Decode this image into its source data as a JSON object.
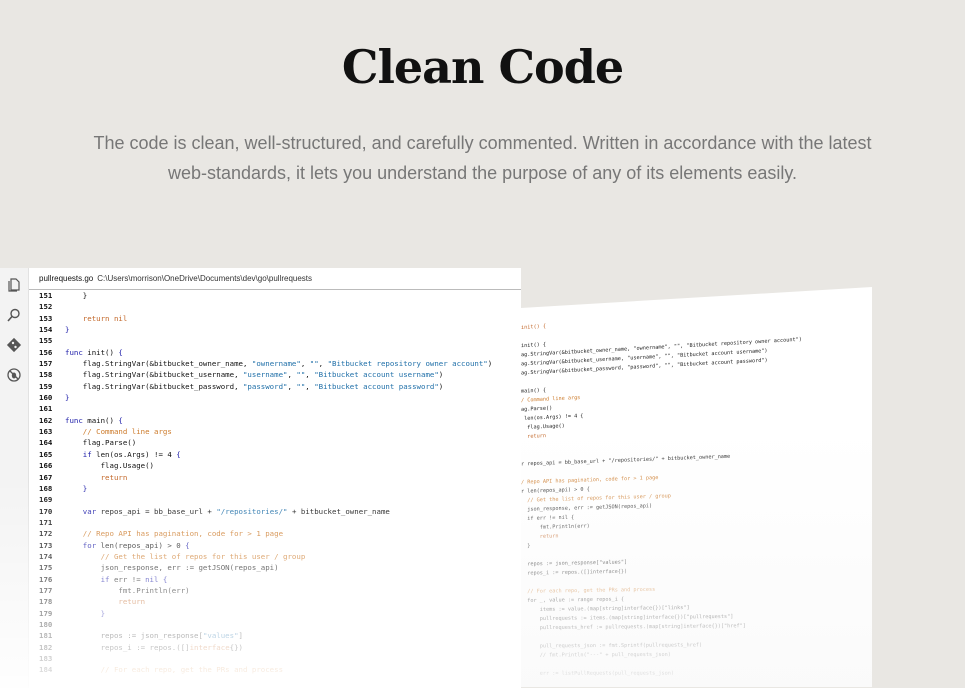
{
  "hero": {
    "title": "Clean Code",
    "subtitle": "The code is clean, well-structured, and carefully commented. Written in accordance with the latest web-standards, it lets you understand the purpose of any of its elements easily."
  },
  "editor": {
    "file_name": "pullrequests.go",
    "file_path": "C:\\Users\\morrison\\OneDrive\\Documents\\dev\\go\\pullrequests",
    "activity_icons": [
      "files-icon",
      "search-icon",
      "source-control-icon",
      "debug-icon"
    ],
    "lines": [
      {
        "n": "151",
        "segs": [
          [
            "plain",
            "    }"
          ]
        ]
      },
      {
        "n": "152",
        "segs": []
      },
      {
        "n": "153",
        "segs": [
          [
            "ret",
            "    return nil"
          ]
        ]
      },
      {
        "n": "154",
        "segs": [
          [
            "kw",
            "}"
          ]
        ]
      },
      {
        "n": "155",
        "segs": []
      },
      {
        "n": "156",
        "segs": [
          [
            "kw",
            "func "
          ],
          [
            "plain",
            "init() "
          ],
          [
            "kw",
            "{"
          ]
        ]
      },
      {
        "n": "157",
        "segs": [
          [
            "plain",
            "    flag.StringVar(&bitbucket_owner_name, "
          ],
          [
            "str",
            "\"ownername\""
          ],
          [
            "plain",
            ", "
          ],
          [
            "str",
            "\"\""
          ],
          [
            "plain",
            ", "
          ],
          [
            "str",
            "\"Bitbucket repository owner account\""
          ],
          [
            "plain",
            ")"
          ]
        ]
      },
      {
        "n": "158",
        "segs": [
          [
            "plain",
            "    flag.StringVar(&bitbucket_username, "
          ],
          [
            "str",
            "\"username\""
          ],
          [
            "plain",
            ", "
          ],
          [
            "str",
            "\"\""
          ],
          [
            "plain",
            ", "
          ],
          [
            "str",
            "\"Bitbucket account username\""
          ],
          [
            "plain",
            ")"
          ]
        ]
      },
      {
        "n": "159",
        "segs": [
          [
            "plain",
            "    flag.StringVar(&bitbucket_password, "
          ],
          [
            "str",
            "\"password\""
          ],
          [
            "plain",
            ", "
          ],
          [
            "str",
            "\"\""
          ],
          [
            "plain",
            ", "
          ],
          [
            "str",
            "\"Bitbucket account password\""
          ],
          [
            "plain",
            ")"
          ]
        ]
      },
      {
        "n": "160",
        "segs": [
          [
            "kw",
            "}"
          ]
        ]
      },
      {
        "n": "161",
        "segs": []
      },
      {
        "n": "162",
        "segs": [
          [
            "kw",
            "func "
          ],
          [
            "plain",
            "main() "
          ],
          [
            "kw",
            "{"
          ]
        ]
      },
      {
        "n": "163",
        "segs": [
          [
            "com",
            "    // Command line args"
          ]
        ]
      },
      {
        "n": "164",
        "segs": [
          [
            "plain",
            "    flag.Parse()"
          ]
        ]
      },
      {
        "n": "165",
        "segs": [
          [
            "kw",
            "    if "
          ],
          [
            "plain",
            "len(os.Args) != 4 "
          ],
          [
            "kw",
            "{"
          ]
        ]
      },
      {
        "n": "166",
        "segs": [
          [
            "plain",
            "        flag.Usage()"
          ]
        ]
      },
      {
        "n": "167",
        "segs": [
          [
            "ret",
            "        return"
          ]
        ]
      },
      {
        "n": "168",
        "segs": [
          [
            "kw",
            "    }"
          ]
        ]
      },
      {
        "n": "169",
        "segs": []
      },
      {
        "n": "170",
        "segs": [
          [
            "kw",
            "    var "
          ],
          [
            "plain",
            "repos_api = bb_base_url + "
          ],
          [
            "str",
            "\"/repositories/\""
          ],
          [
            "plain",
            " + bitbucket_owner_name"
          ]
        ]
      },
      {
        "n": "171",
        "segs": []
      },
      {
        "n": "172",
        "segs": [
          [
            "com",
            "    // Repo API has pagination, code for > 1 page"
          ]
        ]
      },
      {
        "n": "173",
        "segs": [
          [
            "kw",
            "    for "
          ],
          [
            "plain",
            "len(repos_api) > 0 "
          ],
          [
            "kw",
            "{"
          ]
        ]
      },
      {
        "n": "174",
        "segs": [
          [
            "com",
            "        // Get the list of repos for this user / group"
          ]
        ]
      },
      {
        "n": "175",
        "segs": [
          [
            "plain",
            "        json_response, err := getJSON(repos_api)"
          ]
        ]
      },
      {
        "n": "176",
        "segs": [
          [
            "kw",
            "        if "
          ],
          [
            "plain",
            "err != "
          ],
          [
            "kw",
            "nil {"
          ]
        ]
      },
      {
        "n": "177",
        "segs": [
          [
            "plain",
            "            fmt.Println(err)"
          ]
        ]
      },
      {
        "n": "178",
        "segs": [
          [
            "ret",
            "            return"
          ]
        ]
      },
      {
        "n": "179",
        "segs": [
          [
            "kw",
            "        }"
          ]
        ]
      },
      {
        "n": "180",
        "segs": []
      },
      {
        "n": "181",
        "segs": [
          [
            "plain",
            "        repos := json_response["
          ],
          [
            "str",
            "\"values\""
          ],
          [
            "plain",
            "]"
          ]
        ]
      },
      {
        "n": "182",
        "segs": [
          [
            "plain",
            "        repos_i := repos.([]"
          ],
          [
            "ret",
            "interface"
          ],
          [
            "plain",
            "{})"
          ]
        ]
      },
      {
        "n": "183",
        "segs": []
      },
      {
        "n": "184",
        "segs": [
          [
            "com",
            "        // For each repo, get the PRs and process"
          ]
        ]
      }
    ]
  },
  "preview": {
    "lines": [
      {
        "c": "ret",
        "t": "init() {"
      },
      {
        "c": "plain",
        "t": ""
      },
      {
        "c": "plain",
        "t": "init() {"
      },
      {
        "c": "plain",
        "t": "ag.StringVar(&bitbucket_owner_name, \"ownername\", \"\", \"Bitbucket repository owner account\")"
      },
      {
        "c": "plain",
        "t": "ag.StringVar(&bitbucket_username, \"username\", \"\", \"Bitbucket account username\")"
      },
      {
        "c": "plain",
        "t": "ag.StringVar(&bitbucket_password, \"password\", \"\", \"Bitbucket account password\")"
      },
      {
        "c": "plain",
        "t": ""
      },
      {
        "c": "plain",
        "t": "main() {"
      },
      {
        "c": "com",
        "t": "/ Command line args"
      },
      {
        "c": "plain",
        "t": "ag.Parse()"
      },
      {
        "c": "plain",
        "t": " len(os.Args) != 4 {"
      },
      {
        "c": "plain",
        "t": "  flag.Usage()"
      },
      {
        "c": "ret",
        "t": "  return"
      },
      {
        "c": "plain",
        "t": ""
      },
      {
        "c": "plain",
        "t": ""
      },
      {
        "c": "plain",
        "t": "r repos_api = bb_base_url + \"/repositories/\" + bitbucket_owner_name"
      },
      {
        "c": "plain",
        "t": ""
      },
      {
        "c": "com",
        "t": "/ Repo API has pagination, code for > 1 page"
      },
      {
        "c": "plain",
        "t": "r len(repos_api) > 0 {"
      },
      {
        "c": "com",
        "t": "  // Get the list of repos for this user / group"
      },
      {
        "c": "plain",
        "t": "  json_response, err := getJSON(repos_api)"
      },
      {
        "c": "plain",
        "t": "  if err != nil {"
      },
      {
        "c": "plain",
        "t": "      fmt.Println(err)"
      },
      {
        "c": "ret",
        "t": "      return"
      },
      {
        "c": "plain",
        "t": "  }"
      },
      {
        "c": "plain",
        "t": ""
      },
      {
        "c": "plain",
        "t": "  repos := json_response[\"values\"]"
      },
      {
        "c": "plain",
        "t": "  repos_i := repos.([]interface{})"
      },
      {
        "c": "plain",
        "t": ""
      },
      {
        "c": "com",
        "t": "  // For each repo, get the PRs and process"
      },
      {
        "c": "plain",
        "t": "  for _, value := range repos_i {"
      },
      {
        "c": "plain",
        "t": "      items := value.(map[string]interface{})[\"links\"]"
      },
      {
        "c": "plain",
        "t": "      pullrequests := items.(map[string]interface{})[\"pullrequests\"]"
      },
      {
        "c": "plain",
        "t": "      pullrequests_href := pullrequests.(map[string]interface{})[\"href\"]"
      },
      {
        "c": "plain",
        "t": ""
      },
      {
        "c": "plain",
        "t": "      pull_requests_json := fmt.Sprintf(pullrequests_href)"
      },
      {
        "c": "plain",
        "t": "      // fmt.Println(\"---\" + pull_requests_json)"
      },
      {
        "c": "plain",
        "t": ""
      },
      {
        "c": "plain",
        "t": "      err := listPullRequests(pull_requests_json)"
      }
    ]
  }
}
